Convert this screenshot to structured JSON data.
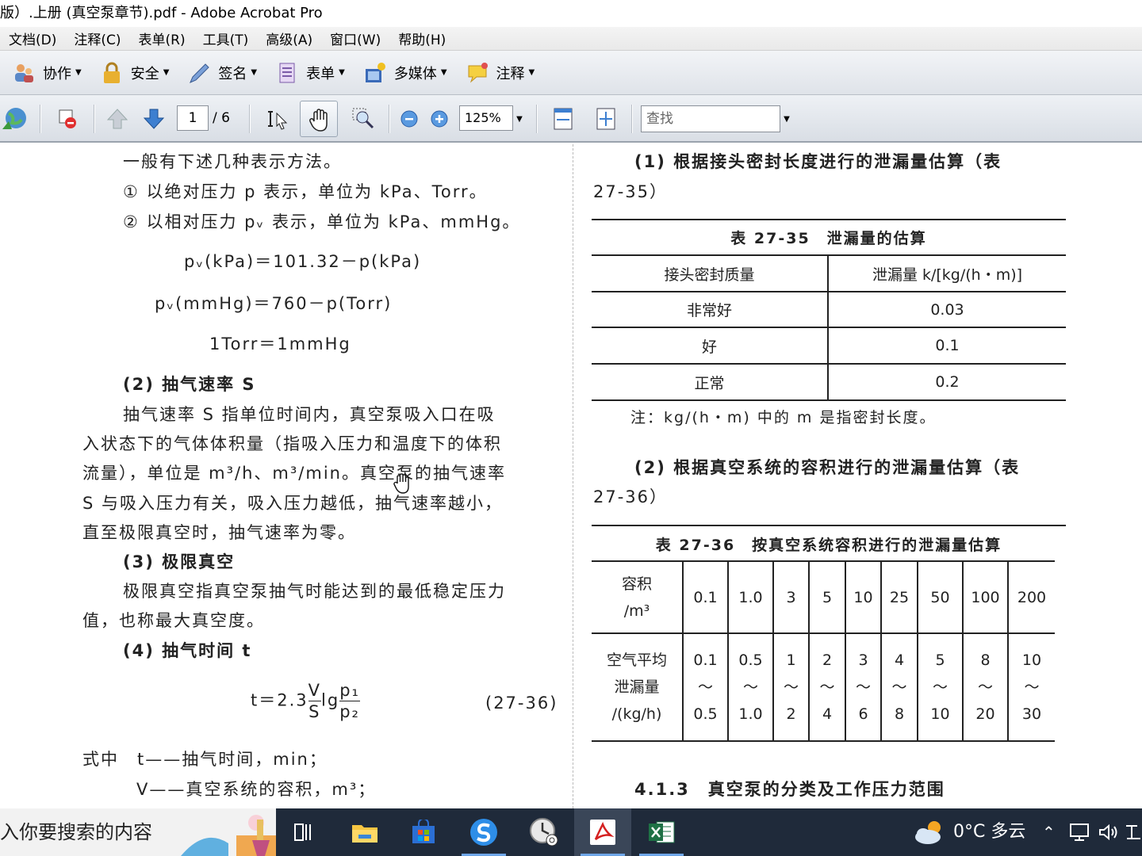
{
  "window": {
    "title": "版）.上册 (真空泵章节).pdf - Adobe Acrobat Pro"
  },
  "menu": [
    "文档(D)",
    "注释(C)",
    "表单(R)",
    "工具(T)",
    "高级(A)",
    "窗口(W)",
    "帮助(H)"
  ],
  "tasks": [
    "协作",
    "安全",
    "签名",
    "表单",
    "多媒体",
    "注释"
  ],
  "nav": {
    "page": "1",
    "page_count": "/ 6",
    "zoom": "125%",
    "find_placeholder": "查找"
  },
  "left": {
    "p1": "一般有下述几种表示方法。",
    "p2": "① 以绝对压力 p 表示，单位为 kPa、Torr。",
    "p3": "② 以相对压力 pᵥ 表示，单位为 kPa、mmHg。",
    "eq1": "pᵥ(kPa)＝101.32－p(kPa)",
    "eq2": "pᵥ(mmHg)＝760－p(Torr)",
    "eq3": "1Torr＝1mmHg",
    "h2": "(2) 抽气速率 S",
    "s2_1": "抽气速率 S 指单位时间内，真空泵吸入口在吸",
    "s2_2": "入状态下的气体体积量（指吸入压力和温度下的体积",
    "s2_3": "流量），单位是 m³/h、m³/min。真空泵的抽气速率",
    "s2_4": "S 与吸入压力有关，吸入压力越低，抽气速率越小，",
    "s2_5": "直至极限真空时，抽气速率为零。",
    "h3": "(3) 极限真空",
    "s3_1": "极限真空指真空泵抽气时能达到的最低稳定压力",
    "s3_2": "值，也称最大真空度。",
    "h4": "(4) 抽气时间 t",
    "eq4_lhs": "t＝2.3",
    "eq4_num": "V",
    "eq4_den": "S",
    "eq4_lg": "lg",
    "eq4_num2": "p₁",
    "eq4_den2": "p₂",
    "eq4_no": "(27-36)",
    "w1": "式中　t——抽气时间，min；",
    "w2": "V——真空系统的容积，m³；"
  },
  "right": {
    "h1a": "(1) 根据接头密封长度进行的泄漏量估算（表",
    "h1b": "27-35）",
    "t35_title": "表 27-35　泄漏量的估算",
    "t35_header": [
      "接头密封质量",
      "泄漏量 k/[kg/(h・m)]"
    ],
    "t35_rows": [
      [
        "非常好",
        "0.03"
      ],
      [
        "好",
        "0.1"
      ],
      [
        "正常",
        "0.2"
      ]
    ],
    "t35_note": "注：kg/(h・m) 中的 m 是指密封长度。",
    "h2a": "(2) 根据真空系统的容积进行的泄漏量估算（表",
    "h2b": "27-36）",
    "t36_title": "表 27-36　按真空系统容积进行的泄漏量估算",
    "t36_label1a": "容积",
    "t36_label1b": "/m³",
    "t36_vol": [
      "0.1",
      "1.0",
      "3",
      "5",
      "10",
      "25",
      "50",
      "100",
      "200"
    ],
    "t36_label2a": "空气平均",
    "t36_label2b": "泄漏量",
    "t36_label2c": "/(kg/h)",
    "t36_low": [
      "0.1",
      "0.5",
      "1",
      "2",
      "3",
      "4",
      "5",
      "8",
      "10"
    ],
    "t36_tilde": "～",
    "t36_high": [
      "0.5",
      "1.0",
      "2",
      "4",
      "6",
      "8",
      "10",
      "20",
      "30"
    ],
    "sec": "4.1.3　真空泵的分类及工作压力范围"
  },
  "taskbar": {
    "search": "入你要搜索的内容",
    "weather": "0°C 多云"
  }
}
